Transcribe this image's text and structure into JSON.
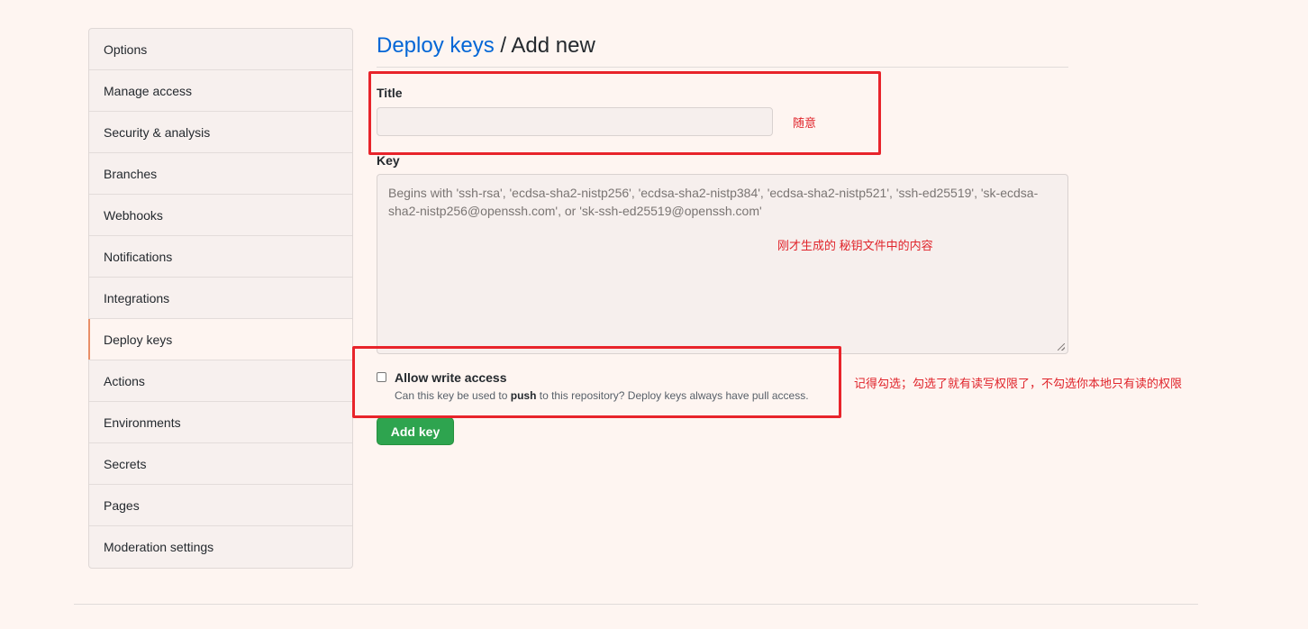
{
  "sidebar": {
    "items": [
      {
        "label": "Options"
      },
      {
        "label": "Manage access"
      },
      {
        "label": "Security & analysis"
      },
      {
        "label": "Branches"
      },
      {
        "label": "Webhooks"
      },
      {
        "label": "Notifications"
      },
      {
        "label": "Integrations"
      },
      {
        "label": "Deploy keys",
        "selected": true
      },
      {
        "label": "Actions"
      },
      {
        "label": "Environments"
      },
      {
        "label": "Secrets"
      },
      {
        "label": "Pages"
      },
      {
        "label": "Moderation settings"
      }
    ]
  },
  "header": {
    "breadcrumb_link": "Deploy keys",
    "separator": "/",
    "title": "Add new"
  },
  "form": {
    "title_label": "Title",
    "title_value": "",
    "key_label": "Key",
    "key_placeholder": "Begins with 'ssh-rsa', 'ecdsa-sha2-nistp256', 'ecdsa-sha2-nistp384', 'ecdsa-sha2-nistp521', 'ssh-ed25519', 'sk-ecdsa-sha2-nistp256@openssh.com', or 'sk-ssh-ed25519@openssh.com'",
    "allow_write_label": "Allow write access",
    "allow_write_checked": false,
    "allow_write_note_before": "Can this key be used to ",
    "allow_write_note_bold": "push",
    "allow_write_note_after": " to this repository? Deploy keys always have pull access.",
    "submit_label": "Add key"
  },
  "annotations": {
    "title_note": "随意",
    "key_note": "刚才生成的 秘钥文件中的内容",
    "write_note": "记得勾选；勾选了就有读写权限了，不勾选你本地只有读的权限"
  },
  "colors": {
    "background": "#fef5f1",
    "link": "#0366d6",
    "primary_button": "#2ea44f",
    "annotation": "#e8242b",
    "selected_indicator": "#e98f68"
  }
}
